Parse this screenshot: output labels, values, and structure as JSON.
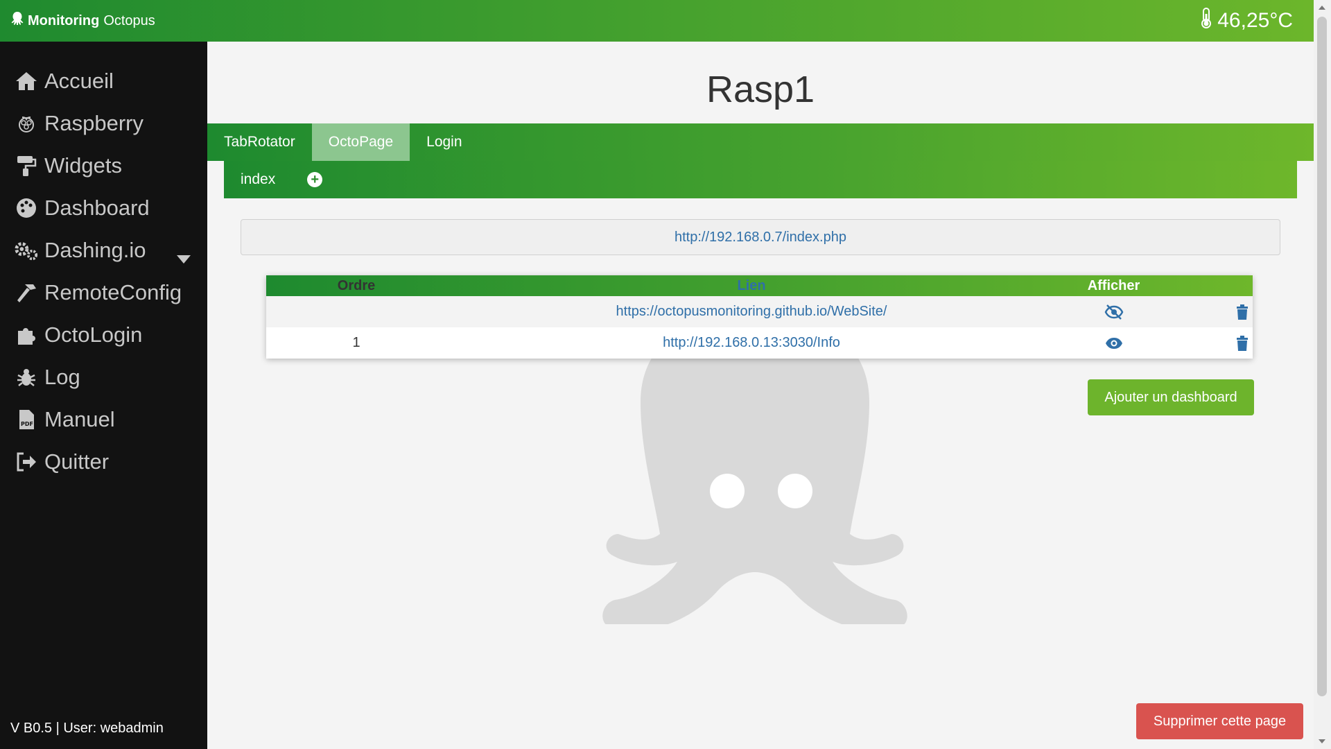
{
  "header": {
    "brand_bold": "Monitoring",
    "brand_rest": "Octopus",
    "temperature": "46,25°C"
  },
  "sidebar": {
    "items": [
      {
        "label": "Accueil",
        "icon": "home-icon"
      },
      {
        "label": "Raspberry",
        "icon": "raspberry-icon"
      },
      {
        "label": "Widgets",
        "icon": "paint-roller-icon"
      },
      {
        "label": "Dashboard",
        "icon": "palette-icon"
      },
      {
        "label": "Dashing.io",
        "icon": "cogs-icon"
      },
      {
        "label": "RemoteConfig",
        "icon": "hammer-icon"
      },
      {
        "label": "OctoLogin",
        "icon": "puzzle-icon"
      },
      {
        "label": "Log",
        "icon": "bug-icon"
      },
      {
        "label": "Manuel",
        "icon": "pdf-icon"
      },
      {
        "label": "Quitter",
        "icon": "sign-out-icon"
      }
    ],
    "footer": "V B0.5 | User: webadmin"
  },
  "main": {
    "title": "Rasp1",
    "tabs": [
      "TabRotator",
      "OctoPage",
      "Login"
    ],
    "active_tab": "OctoPage",
    "subtabs": [
      "index"
    ],
    "url": "http://192.168.0.7/index.php",
    "table": {
      "headers": [
        "Ordre",
        "Lien",
        "Afficher"
      ],
      "rows": [
        {
          "ordre": "",
          "lien": "https://octopusmonitoring.github.io/WebSite/",
          "afficher": "hidden"
        },
        {
          "ordre": "1",
          "lien": "http://192.168.0.13:3030/Info",
          "afficher": "visible"
        }
      ]
    },
    "add_button": "Ajouter un dashboard",
    "delete_page_button": "Supprimer cette page"
  },
  "colors": {
    "green_dark": "#1f8a2f",
    "green_light": "#6cb62b",
    "sidebar_bg": "#121212",
    "link": "#2f6fa8",
    "danger": "#d9534f"
  }
}
